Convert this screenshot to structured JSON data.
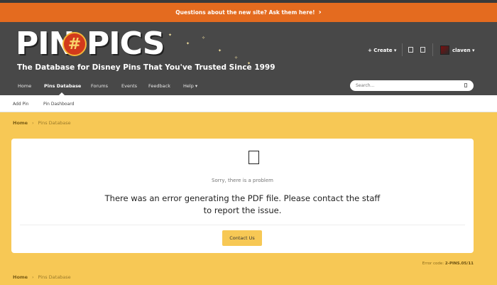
{
  "announcement": {
    "text": "Questions about the new site? Ask them here!",
    "chevron": "›"
  },
  "logo": {
    "word1": "PIN",
    "hash": "#",
    "word2": "PICS",
    "tagline": "The Database for Disney Pins That You've Trusted Since 1999"
  },
  "user_nav": {
    "create": "+ Create ▾",
    "notifications_icon": "bell-icon",
    "messages_icon": "envelope-icon",
    "username": "claven ▾"
  },
  "nav": {
    "items": [
      "Home",
      "Pins Database",
      "Forums",
      "Events",
      "Feedback",
      "Help ▾"
    ],
    "active": "Pins Database",
    "search_placeholder": "Search..."
  },
  "subnav": {
    "items": [
      "Add Pin",
      "Pin Dashboard"
    ]
  },
  "breadcrumb": {
    "home": "Home",
    "separator": "›",
    "current": "Pins Database"
  },
  "error": {
    "small": "Sorry, there is a problem",
    "message": "There was an error generating the PDF file. Please contact the staff to report the issue.",
    "button": "Contact Us",
    "code_label": "Error code:",
    "code": "2-PINS.05/11"
  },
  "colors": {
    "announce": "#e46b1f",
    "header": "#484848",
    "page_bg": "#f7c855",
    "accent": "#f7c855"
  }
}
